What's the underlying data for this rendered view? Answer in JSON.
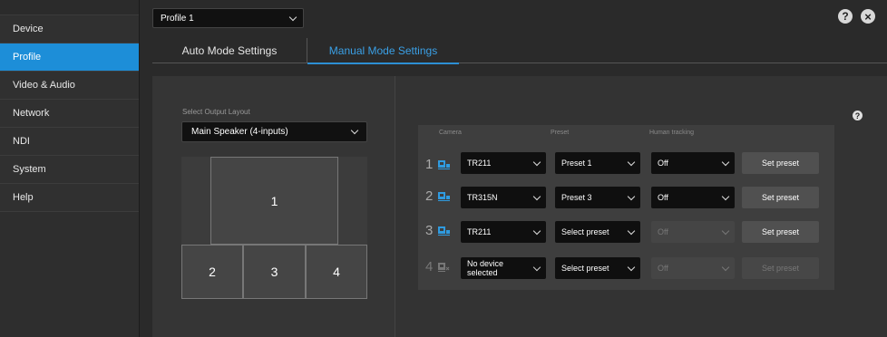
{
  "sidebar": {
    "items": [
      {
        "label": "Device"
      },
      {
        "label": "Profile"
      },
      {
        "label": "Video & Audio"
      },
      {
        "label": "Network"
      },
      {
        "label": "NDI"
      },
      {
        "label": "System"
      },
      {
        "label": "Help"
      }
    ],
    "active_index": 1
  },
  "header": {
    "profile_select": {
      "value": "Profile 1"
    },
    "help_icon": "?",
    "close_icon": "×"
  },
  "tabs": [
    {
      "label": "Auto Mode Settings",
      "active": false
    },
    {
      "label": "Manual Mode Settings",
      "active": true
    }
  ],
  "layout": {
    "label": "Select Output Layout",
    "selected": "Main Speaker (4-inputs)",
    "cells": [
      "1",
      "2",
      "3",
      "4"
    ]
  },
  "table": {
    "help_icon": "?",
    "columns": [
      "Camera",
      "Preset",
      "Human tracking"
    ],
    "rows": [
      {
        "num": "1",
        "camera": "TR211",
        "preset": "Preset 1",
        "tracking": "Off",
        "button": "Set preset",
        "camera_icon": "camera-connected-icon",
        "tracking_enabled": true,
        "button_enabled": true
      },
      {
        "num": "2",
        "camera": "TR315N",
        "preset": "Preset 3",
        "tracking": "Off",
        "button": "Set preset",
        "camera_icon": "camera-connected-icon",
        "tracking_enabled": true,
        "button_enabled": true
      },
      {
        "num": "3",
        "camera": "TR211",
        "preset": "Select preset",
        "tracking": "Off",
        "button": "Set preset",
        "camera_icon": "camera-connected-icon",
        "tracking_enabled": false,
        "button_enabled": true
      },
      {
        "num": "4",
        "camera": "No device selected",
        "preset": "Select preset",
        "tracking": "Off",
        "button": "Set preset",
        "camera_icon": "camera-disconnected-icon",
        "tracking_enabled": false,
        "button_enabled": false
      }
    ]
  },
  "colors": {
    "accent": "#1d8ed8",
    "tab_active": "#3aa0e6",
    "camera_icon": "#2f9be0"
  }
}
